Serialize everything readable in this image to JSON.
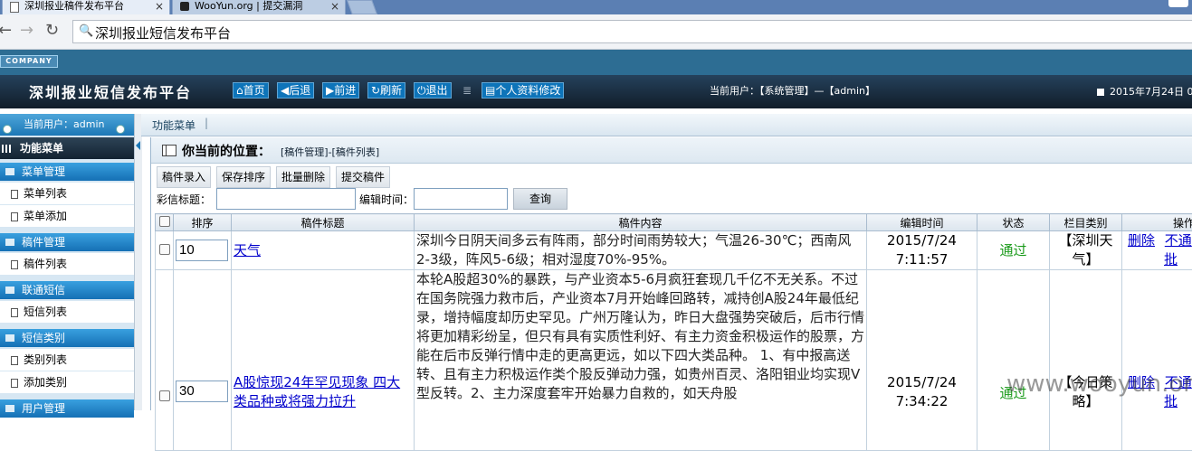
{
  "browser": {
    "tabs": [
      {
        "title": "深圳报业稿件发布平台"
      },
      {
        "title": "WooYun.org | 提交漏洞"
      }
    ],
    "address": "深圳报业短信发布平台",
    "close_glyph": "×"
  },
  "header": {
    "company": "COMPANY",
    "site_title": "深圳报业短信发布平台",
    "buttons": [
      "首页",
      "后退",
      "前进",
      "刷新",
      "退出"
    ],
    "profile_button": "个人资料修改",
    "separator": "≣",
    "current_user": "当前用户：【系统管理】—【admin】",
    "date": "2015年7月24日 0"
  },
  "sidebar": {
    "current_user": "当前用户：admin",
    "menu_title": "功能菜单",
    "groups": [
      {
        "title": "菜单管理",
        "items": [
          "菜单列表",
          "菜单添加"
        ]
      },
      {
        "title": "稿件管理",
        "items": [
          "稿件列表"
        ]
      },
      {
        "title": "联通短信",
        "items": [
          "短信列表"
        ]
      },
      {
        "title": "短信类别",
        "items": [
          "类别列表",
          "添加类别"
        ]
      },
      {
        "title": "用户管理",
        "items": []
      }
    ]
  },
  "funcbar": {
    "label": "功能菜单",
    "sep": "|"
  },
  "location": {
    "label": "你当前的位置：",
    "path": "[稿件管理]-[稿件列表]"
  },
  "actions": [
    "稿件录入",
    "保存排序",
    "批量删除",
    "提交稿件"
  ],
  "filters": {
    "title_label": "彩信标题：",
    "time_label": "编辑时间：",
    "query_button": "查询"
  },
  "table": {
    "columns": [
      "",
      "排序",
      "稿件标题",
      "稿件内容",
      "编辑时间",
      "状态",
      "栏目类别",
      "操作"
    ],
    "rows": [
      {
        "sort": "10",
        "title": "天气",
        "content": "深圳今日阴天间多云有阵雨，部分时间雨势较大；气温26-30℃；西南风2-3级，阵风5-6级；相对湿度70%-95%。",
        "time_date": "2015/7/24",
        "time_clock": "7:11:57",
        "status": "通过",
        "category": "【深圳天气】",
        "op_delete": "删除",
        "op_a": "不通",
        "op_b": "批"
      },
      {
        "sort": "30",
        "title": "A股惊现24年罕见现象 四大类品种或将强力拉升",
        "content": "本轮A股超30%的暴跌，与产业资本5-6月疯狂套现几千亿不无关系。不过在国务院强力救市后，产业资本7月开始峰回路转，减持创A股24年最低纪录，增持幅度却历史罕见。广州万隆认为，昨日大盘强势突破后，后市行情将更加精彩纷呈，但只有具有实质性利好、有主力资金积极运作的股票，方能在后市反弹行情中走的更高更远，如以下四大类品种。 1、有中报高送转、且有主力积极运作类个股反弹动力强，如贵州百灵、洛阳钼业均实现V型反转。2、主力深度套牢开始暴力自救的，如天舟股",
        "time_date": "2015/7/24",
        "time_clock": "7:34:22",
        "status": "通过",
        "category": "【今日策略】",
        "op_delete": "删除",
        "op_a": "不通",
        "op_b": "批"
      }
    ]
  },
  "watermark": "www.wooyun.org"
}
